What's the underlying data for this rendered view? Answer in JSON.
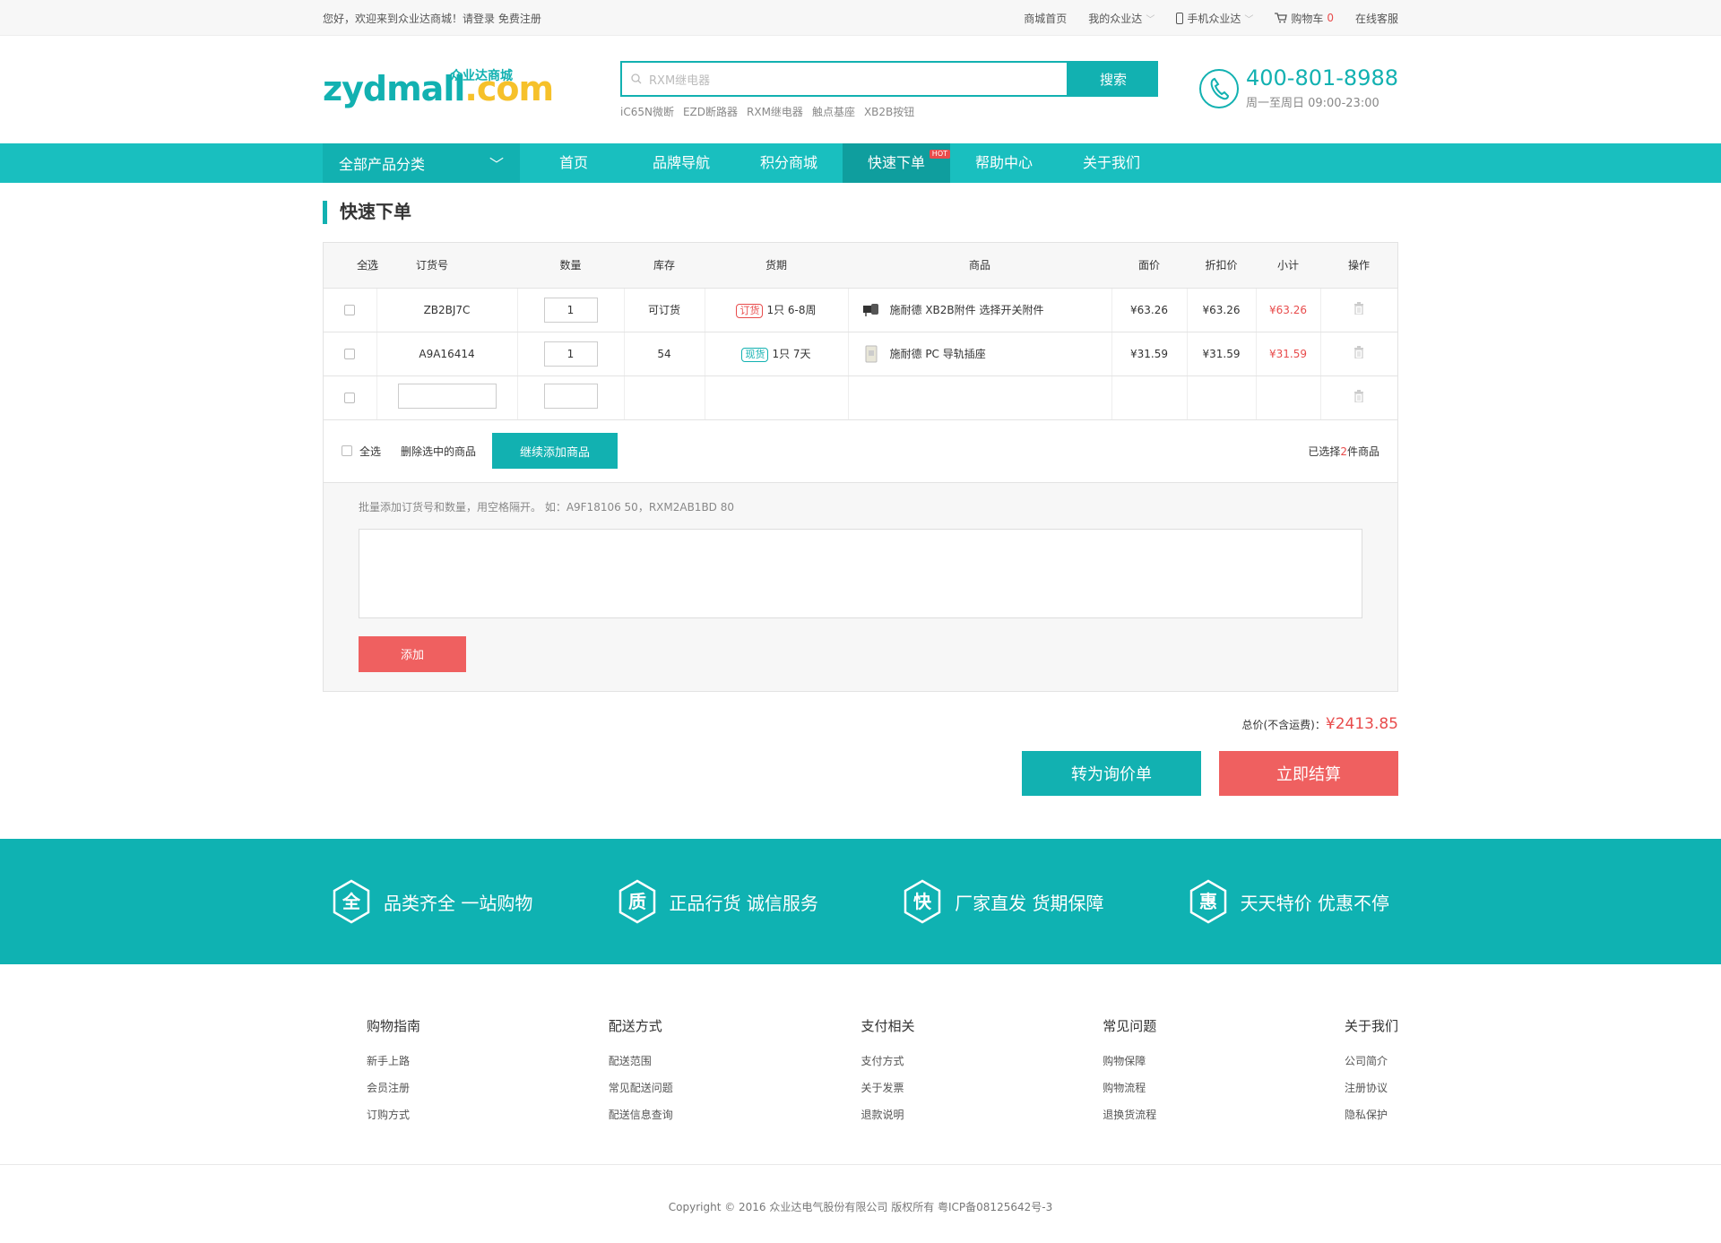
{
  "topbar": {
    "welcome": "您好，欢迎来到众业达商城！请登录 免费注册",
    "links": [
      "商城首页",
      "我的众业达",
      "手机众业达",
      "购物车",
      "在线客服"
    ],
    "cart_count": "0"
  },
  "logo": {
    "main": "zydmall",
    "dot": ".",
    "com": "com",
    "cn": "众业达商城"
  },
  "search": {
    "placeholder": "RXM继电器",
    "button": "搜索",
    "hot": [
      "iC65N微断",
      "EZD断路器",
      "RXM继电器",
      "触点基座",
      "XB2B按钮"
    ]
  },
  "hotline": {
    "number": "400-801-8988",
    "time": "周一至周日 09:00-23:00"
  },
  "nav": {
    "category": "全部产品分类",
    "items": [
      "首页",
      "品牌导航",
      "积分商城",
      "快速下单",
      "帮助中心",
      "关于我们"
    ],
    "hot_badge": "HOT"
  },
  "page_title": "快速下单",
  "table": {
    "headers": [
      "全选",
      "订货号",
      "数量",
      "库存",
      "货期",
      "商品",
      "面价",
      "折扣价",
      "小计",
      "操作"
    ],
    "rows": [
      {
        "code": "ZB2BJ7C",
        "qty": "1",
        "stock": "可订货",
        "tag": "订货",
        "lead": "1只 6-8周",
        "product": "施耐德 XB2B附件 选择开关附件",
        "price": "¥63.26",
        "discount": "¥63.26",
        "subtotal": "¥63.26"
      },
      {
        "code": "A9A16414",
        "qty": "1",
        "stock": "54",
        "tag": "现货",
        "lead": "1只 7天",
        "product": "施耐德 PC 导轨插座",
        "price": "¥31.59",
        "discount": "¥31.59",
        "subtotal": "¥31.59"
      }
    ]
  },
  "actions": {
    "select_all": "全选",
    "delete_selected": "删除选中的商品",
    "continue_add": "继续添加商品",
    "selected_prefix": "已选择",
    "selected_count": "2",
    "selected_suffix": "件商品"
  },
  "batch": {
    "tip": "批量添加订货号和数量，用空格隔开。 如：A9F18106  50，RXM2AB1BD  80",
    "add_button": "添加"
  },
  "total": {
    "label": "总价(不含运费)：",
    "amount": "¥2413.85"
  },
  "buttons": {
    "inquiry": "转为询价单",
    "checkout": "立即结算"
  },
  "features": [
    {
      "icon": "全",
      "text": "品类齐全  一站购物"
    },
    {
      "icon": "质",
      "text": "正品行货  诚信服务"
    },
    {
      "icon": "快",
      "text": "厂家直发  货期保障"
    },
    {
      "icon": "惠",
      "text": "天天特价  优惠不停"
    }
  ],
  "footer": {
    "columns": [
      {
        "title": "购物指南",
        "links": [
          "新手上路",
          "会员注册",
          "订购方式"
        ]
      },
      {
        "title": "配送方式",
        "links": [
          "配送范围",
          "常见配送问题",
          "配送信息查询"
        ]
      },
      {
        "title": "支付相关",
        "links": [
          "支付方式",
          "关于发票",
          "退款说明"
        ]
      },
      {
        "title": "常见问题",
        "links": [
          "购物保障",
          "购物流程",
          "退换货流程"
        ]
      },
      {
        "title": "关于我们",
        "links": [
          "公司简介",
          "注册协议",
          "隐私保护"
        ]
      }
    ],
    "copyright": "Copyright © 2016 众业达电气股份有限公司 版权所有 粤ICP备08125642号-3"
  },
  "colors": {
    "teal": "#12b1b1",
    "red": "#e84c4c",
    "yellow": "#f6c12a"
  }
}
